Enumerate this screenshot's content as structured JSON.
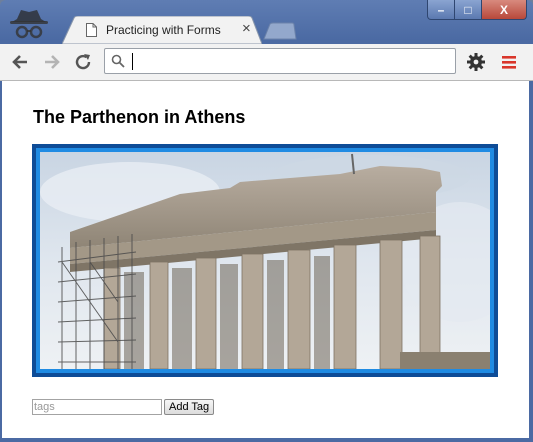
{
  "window": {
    "min_glyph": "–",
    "max_glyph": "□",
    "close_glyph": "X"
  },
  "tab": {
    "title": "Practicing with Forms",
    "close_glyph": "×"
  },
  "omnibox": {
    "value": ""
  },
  "page": {
    "heading": "The Parthenon in Athens",
    "image_alt": "Parthenon photo"
  },
  "form": {
    "tags_placeholder": "tags",
    "tags_value": "",
    "add_button_label": "Add Tag"
  },
  "colors": {
    "frame_outer": "#0e4c97",
    "frame_inner": "#1f8be3",
    "menu_icon": "#d9362b"
  }
}
